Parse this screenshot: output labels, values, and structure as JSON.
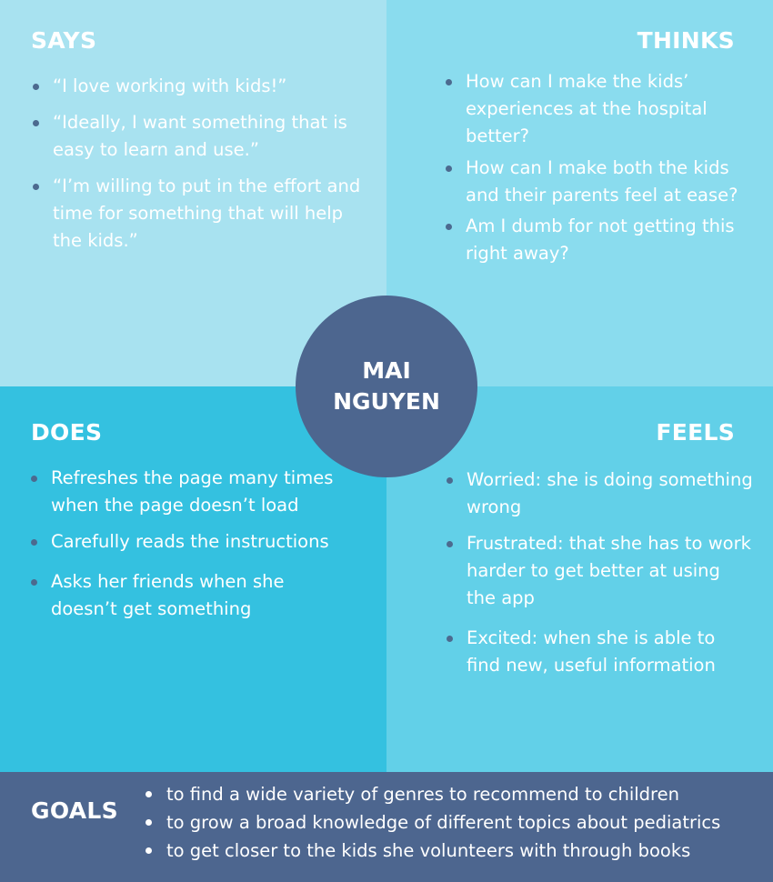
{
  "center": {
    "name": "MAI NGUYEN"
  },
  "says": {
    "title": "SAYS",
    "items": [
      "“I love working with kids!”",
      "“Ideally, I want something that is easy to learn and use.”",
      "“I’m willing to put in the effort and time for something that will help the kids.”"
    ]
  },
  "thinks": {
    "title": "THINKS",
    "items": [
      "How can I make the kids’ experiences at the hospital better?",
      "How can I make both the kids and their parents feel at ease?",
      "Am I dumb for not getting this right away?"
    ]
  },
  "does": {
    "title": "DOES",
    "items": [
      "Refreshes the page many times when the page doesn’t load",
      "Carefully reads the instructions",
      "Asks her friends when she doesn’t get something"
    ]
  },
  "feels": {
    "title": "FEELS",
    "items": [
      "Worried: she is doing something wrong",
      "Frustrated: that she has to work harder to get better at using the app",
      "Excited: when she is able to find new, useful information"
    ]
  },
  "goals": {
    "title": "GOALS",
    "items": [
      "to find a wide variety of genres to recommend to children",
      "to grow a broad knowledge of different topics about pediatrics",
      "to get closer to the kids she volunteers with through books"
    ]
  },
  "colors": {
    "says_bg": "#a8e2f0",
    "thinks_bg": "#8adcee",
    "does_bg": "#34c1e0",
    "feels_bg": "#62d0e8",
    "accent_navy": "#4d668f"
  }
}
